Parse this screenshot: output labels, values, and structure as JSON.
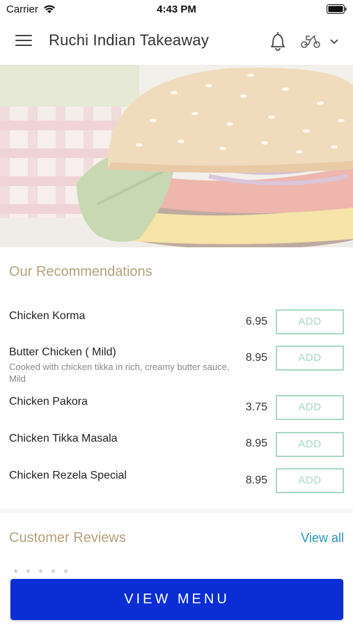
{
  "status_bar": {
    "carrier": "Carrier",
    "time": "4:43 PM",
    "wifi_icon": "wifi-icon",
    "battery_icon": "battery-icon"
  },
  "header": {
    "title": "Ruchi Indian Takeaway",
    "menu_icon": "hamburger-icon",
    "notification_icon": "bell-icon",
    "delivery_icon": "scooter-icon",
    "dropdown_icon": "chevron-down-icon"
  },
  "hero": {
    "image": "burger-hero-image"
  },
  "recommendations": {
    "title": "Our Recommendations",
    "items": [
      {
        "name": "Chicken Korma",
        "description": "",
        "price": "6.95",
        "button": "ADD"
      },
      {
        "name": "Butter Chicken ( Mild)",
        "description": "Cooked with chicken tikka in rich, creamy butter sauce, Mild",
        "price": "8.95",
        "button": "ADD"
      },
      {
        "name": "Chicken Pakora",
        "description": "",
        "price": "3.75",
        "button": "ADD"
      },
      {
        "name": "Chicken Tikka Masala",
        "description": "",
        "price": "8.95",
        "button": "ADD"
      },
      {
        "name": "Chicken Rezela Special",
        "description": "",
        "price": "8.95",
        "button": "ADD"
      }
    ]
  },
  "reviews": {
    "title": "Customer Reviews",
    "view_all": "View all",
    "stars": "★★★★★"
  },
  "footer": {
    "view_menu": "VIEW MENU"
  },
  "colors": {
    "accent_gold": "#b3a27c",
    "add_button_green": "#a8d9c1",
    "link_blue": "#2a93b8",
    "primary_button_blue": "#0a2ed4"
  }
}
